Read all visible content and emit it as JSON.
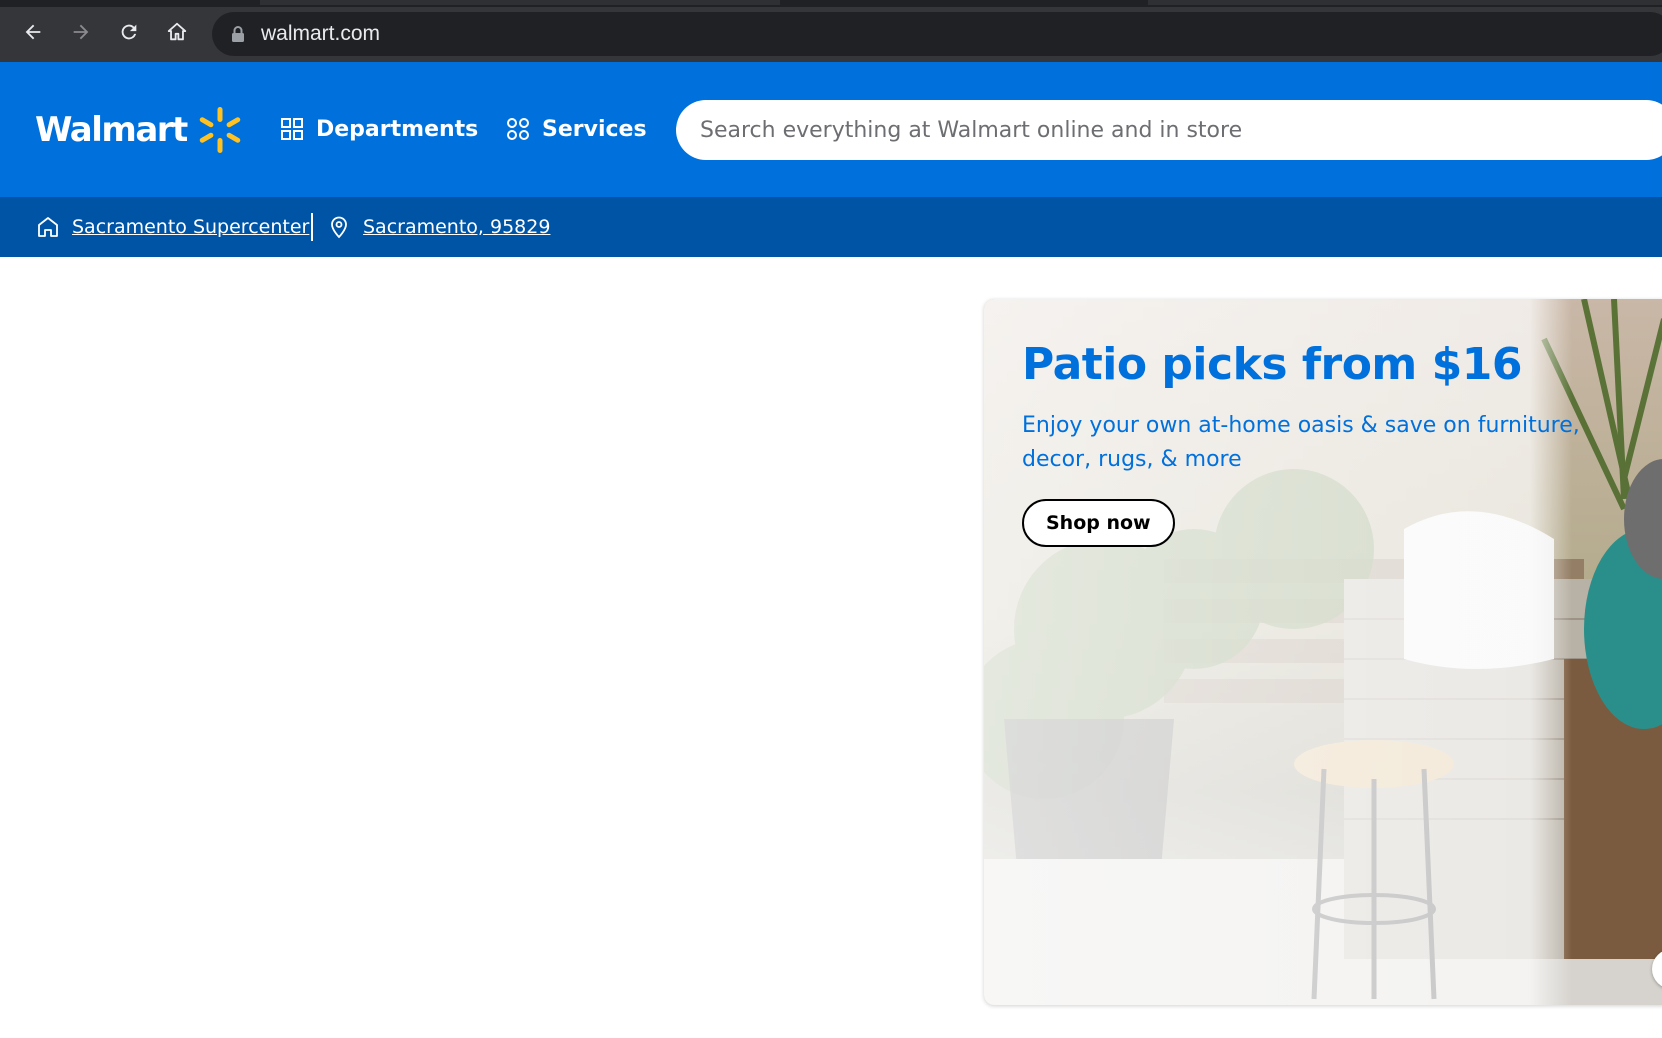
{
  "browser": {
    "url": "walmart.com",
    "icons": [
      "back-arrow-icon",
      "forward-arrow-icon",
      "reload-icon",
      "home-icon",
      "lock-icon"
    ]
  },
  "header": {
    "logo_text": "Walmart",
    "nav": [
      {
        "label": "Departments",
        "icon": "grid-icon"
      },
      {
        "label": "Services",
        "icon": "services-icon"
      }
    ],
    "search_placeholder": "Search everything at Walmart online and in store",
    "colors": {
      "header_bg": "#0071dc",
      "locbar_bg": "#0054a6",
      "spark": "#ffc220"
    }
  },
  "location": {
    "store": "Sacramento Supercenter",
    "zip": "Sacramento, 95829"
  },
  "hero": {
    "title": "Patio picks from $16",
    "subtitle": "Enjoy your own at-home oasis & save on furniture, decor, rugs, & more",
    "cta": "Shop now"
  }
}
